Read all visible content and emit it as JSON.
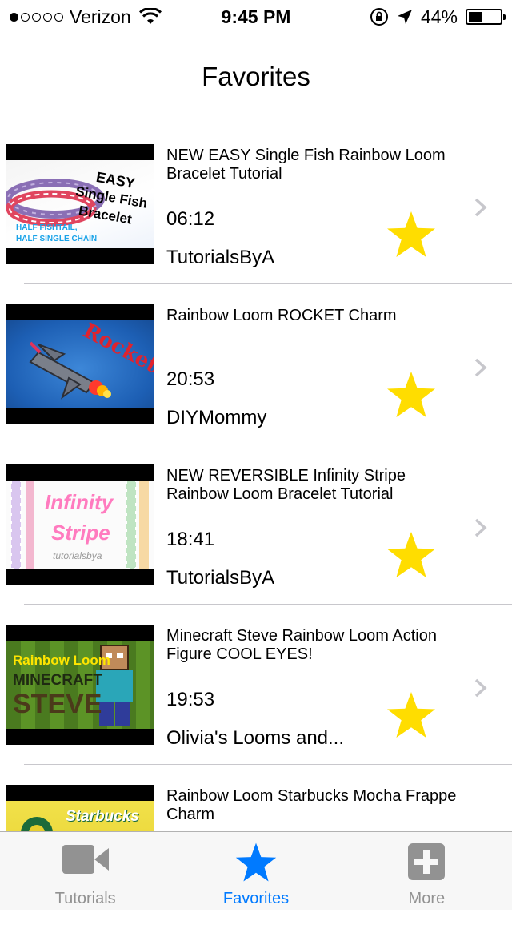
{
  "status_bar": {
    "signal_bars_filled": 1,
    "signal_bars_total": 5,
    "carrier": "Verizon",
    "time": "9:45 PM",
    "battery_percent": "44%",
    "battery_level": 0.44
  },
  "nav": {
    "title": "Favorites"
  },
  "favorites": [
    {
      "title": "NEW EASY Single Fish Rainbow Loom Bracelet Tutorial",
      "duration": "06:12",
      "channel": "TutorialsByA",
      "thumb_text": [
        "EASY",
        "Single Fish",
        "Bracelet",
        "HALF FISHTAIL,",
        "HALF SINGLE CHAIN"
      ]
    },
    {
      "title": "Rainbow Loom ROCKET Charm",
      "duration": "20:53",
      "channel": "DIYMommy",
      "thumb_text": [
        "Rocket"
      ]
    },
    {
      "title": "NEW REVERSIBLE Infinity Stripe Rainbow Loom Bracelet Tutorial",
      "duration": "18:41",
      "channel": "TutorialsByA",
      "thumb_text": [
        "Infinity",
        "Stripe",
        "tutorialsbya"
      ]
    },
    {
      "title": "Minecraft Steve Rainbow Loom Action Figure COOL EYES!",
      "duration": "19:53",
      "channel": "Olivia's Looms and...",
      "thumb_text": [
        "Rainbow Loom",
        "MINECRAFT",
        "STEVE"
      ]
    },
    {
      "title": "Rainbow Loom Starbucks Mocha Frappe Charm",
      "duration": "",
      "channel": "",
      "thumb_text": [
        "Starbucks"
      ]
    }
  ],
  "tab_bar": {
    "tabs": [
      {
        "label": "Tutorials",
        "icon": "video-camera-icon",
        "active": false
      },
      {
        "label": "Favorites",
        "icon": "star-icon",
        "active": true
      },
      {
        "label": "More",
        "icon": "plus-square-icon",
        "active": false
      }
    ]
  },
  "colors": {
    "accent": "#007aff",
    "star": "#ffdd00",
    "inactive_tab": "#929292",
    "separator": "#c8c7cc",
    "chevron": "#c7c7cc"
  }
}
